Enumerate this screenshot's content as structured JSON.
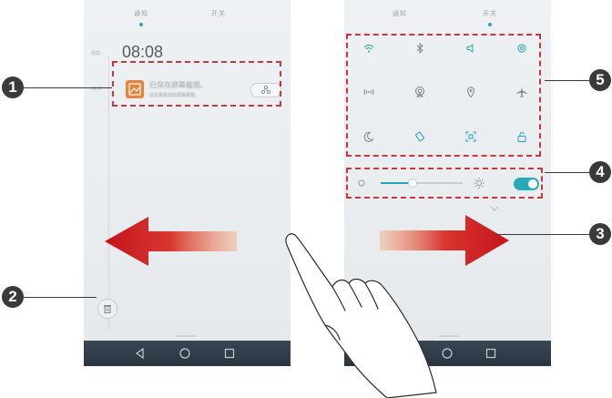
{
  "left_screen": {
    "tabs": [
      "通知",
      "开关"
    ],
    "time": "08:08",
    "date_label": "周四",
    "notification": {
      "app_icon": "gallery-app-icon",
      "title": "已保存屏幕截图。",
      "subtitle": "点击查看您的屏幕截图。"
    },
    "share_icon": "share-icon",
    "delete_icon": "trash-icon",
    "swipe_direction": "left"
  },
  "right_screen": {
    "tabs": [
      "通知",
      "开关"
    ],
    "quick_settings": [
      "wifi-icon",
      "bluetooth-icon",
      "sound-icon",
      "settings-icon",
      "hotspot-icon",
      "wireless-projection-icon",
      "location-icon",
      "airplane-mode-icon",
      "do-not-disturb-icon",
      "auto-rotate-icon",
      "screenshot-icon",
      "lock-screen-icon"
    ],
    "brightness": 0.38,
    "auto_brightness": "on",
    "swipe_direction": "right"
  },
  "callouts": [
    "1",
    "2",
    "3",
    "4",
    "5"
  ],
  "navbar_icons": [
    "back-icon",
    "home-icon",
    "recents-icon"
  ],
  "colors": {
    "accent": "#25a7b7",
    "dashed_box": "#d0343a",
    "arrow": "#c4141d",
    "navbar": "#2f3b48",
    "callout": "#3a3a3a"
  }
}
